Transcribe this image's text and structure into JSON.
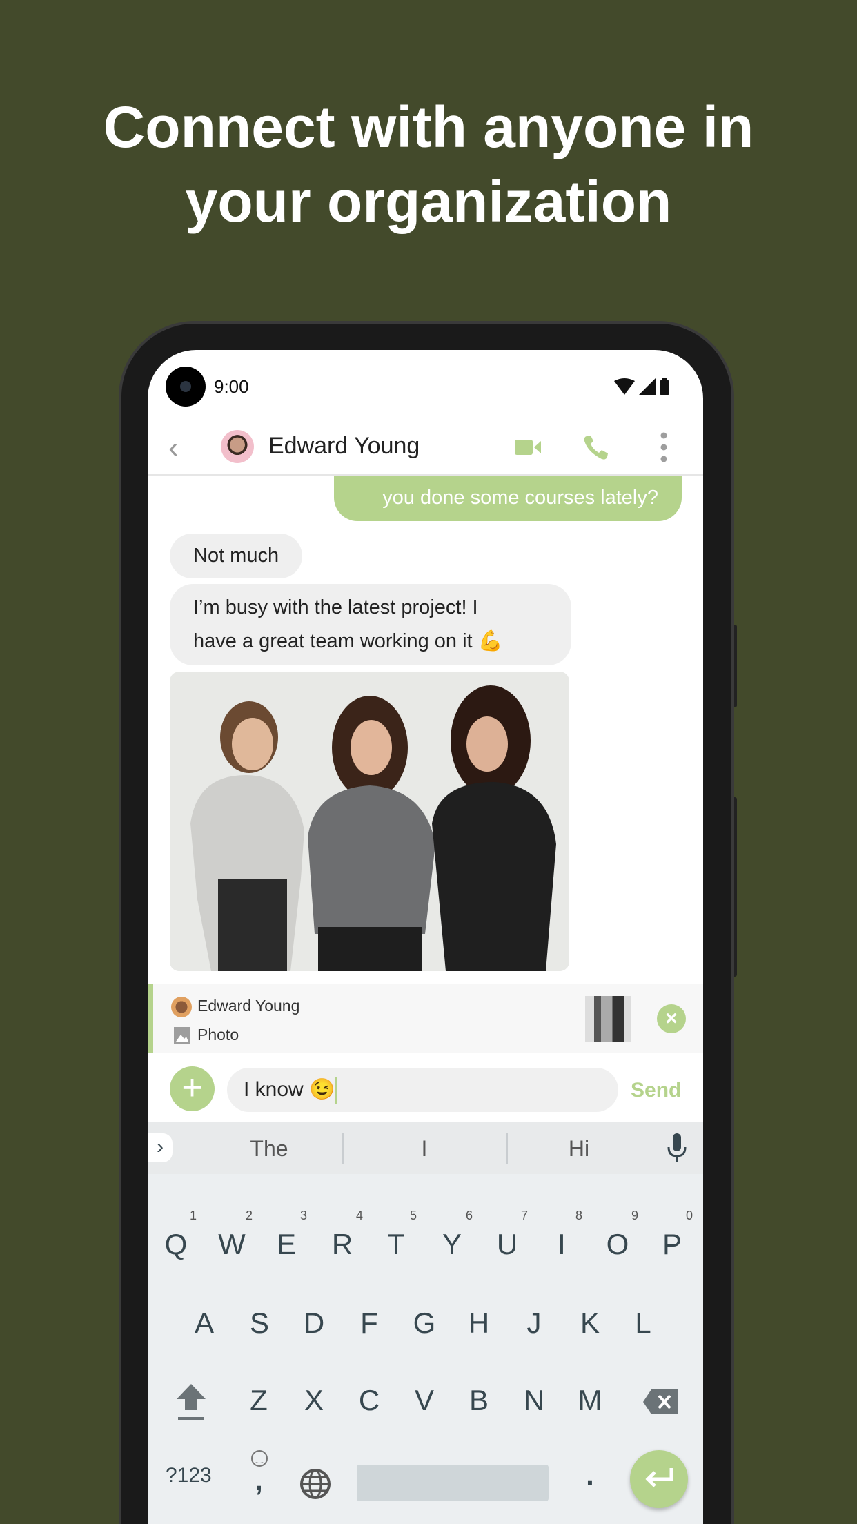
{
  "headline": {
    "line1": "Connect with anyone in",
    "line2": "your organization"
  },
  "status": {
    "time": "9:00"
  },
  "header": {
    "contact_name": "Edward Young"
  },
  "messages": {
    "outgoing": "you done some courses lately?",
    "incoming1": "Not much",
    "incoming2_line1": "I’m busy with the latest project! I",
    "incoming2_line2": "have a great team working on it 💪"
  },
  "reply": {
    "author": "Edward Young",
    "type": "Photo"
  },
  "composer": {
    "value": "I know 😉",
    "send_label": "Send"
  },
  "suggestions": [
    "The",
    "I",
    "Hi"
  ],
  "keyboard": {
    "row1": [
      "Q",
      "W",
      "E",
      "R",
      "T",
      "Y",
      "U",
      "I",
      "O",
      "P"
    ],
    "hints": [
      "1",
      "2",
      "3",
      "4",
      "5",
      "6",
      "7",
      "8",
      "9",
      "0"
    ],
    "row2": [
      "A",
      "S",
      "D",
      "F",
      "G",
      "H",
      "J",
      "K",
      "L"
    ],
    "row3": [
      "Z",
      "X",
      "C",
      "V",
      "B",
      "N",
      "M"
    ],
    "symbols_label": "?123",
    "comma": ",",
    "period": "."
  },
  "colors": {
    "accent": "#b5d38c",
    "background": "#434a2b"
  }
}
